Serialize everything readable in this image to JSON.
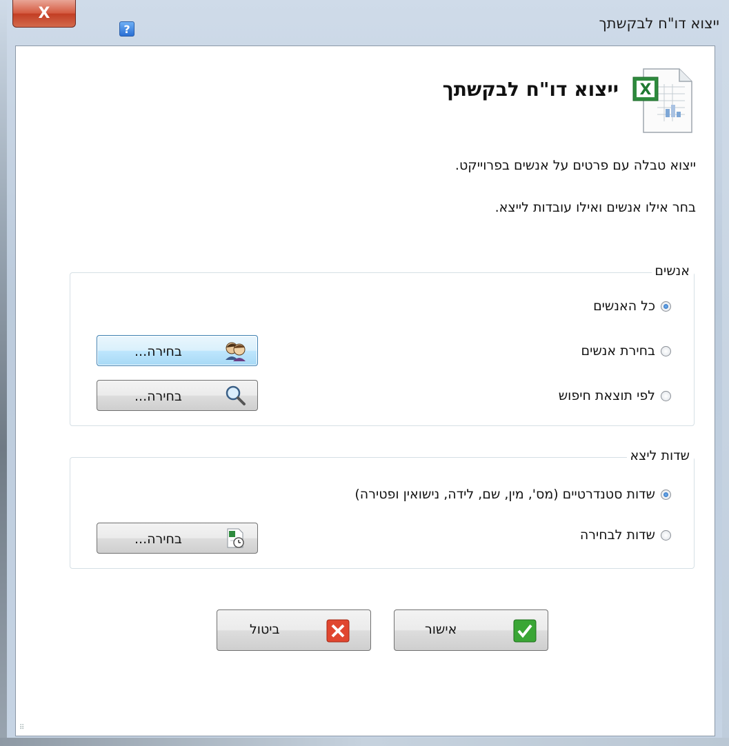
{
  "window": {
    "title": "ייצוא דו\"ח לבקשתך",
    "close_glyph": "X",
    "help_glyph": "?"
  },
  "header": {
    "heading": "ייצוא דו\"ח לבקשתך",
    "icon": "excel-file-icon"
  },
  "description": {
    "line1": "ייצוא טבלה עם פרטים על אנשים בפרוייקט.",
    "line2": "בחר אילו אנשים ואילו עובדות לייצא."
  },
  "people_group": {
    "title": "אנשים",
    "options": [
      {
        "label": "כל האנשים",
        "selected": true
      },
      {
        "label": "בחירת אנשים",
        "selected": false
      },
      {
        "label": "לפי תוצאת חיפוש",
        "selected": false
      }
    ],
    "select_people_button": {
      "label": "בחירה...",
      "icon": "people-icon"
    },
    "search_button": {
      "label": "בחירה...",
      "icon": "magnifier-icon"
    }
  },
  "fields_group": {
    "title": "שדות ליצא",
    "options": [
      {
        "label": "שדות סטנדרטיים (מס', מין, שם, לידה, נישואין ופטירה)",
        "selected": true
      },
      {
        "label": "שדות לבחירה",
        "selected": false
      }
    ],
    "fields_button": {
      "label": "בחירה...",
      "icon": "fields-clock-icon"
    }
  },
  "footer": {
    "ok_label": "אישור",
    "cancel_label": "ביטול",
    "ok_icon": "checkmark-icon",
    "cancel_icon": "red-x-icon"
  },
  "colors": {
    "ok_green": "#3aa635",
    "cancel_red": "#e0462f",
    "close_red": "#c9432a"
  }
}
